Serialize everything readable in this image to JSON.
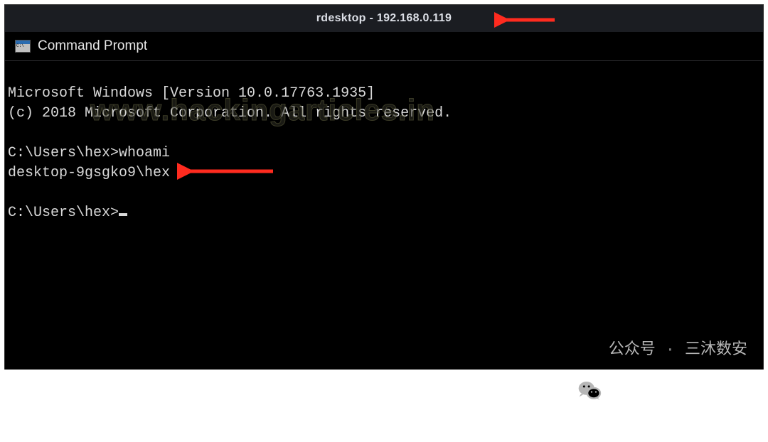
{
  "rdesktop": {
    "title": "rdesktop - 192.168.0.119"
  },
  "cmd": {
    "icon_name": "command-prompt-icon",
    "title": "Command Prompt"
  },
  "terminal_lines": {
    "l0": "Microsoft Windows [Version 10.0.17763.1935]",
    "l1": "(c) 2018 Microsoft Corporation. All rights reserved.",
    "l2": "",
    "l3_prompt": "C:\\Users\\hex>",
    "l3_cmd": "whoami",
    "l4": "desktop-9gsgko9\\hex",
    "l5": "",
    "l6_prompt": "C:\\Users\\hex>"
  },
  "watermark": {
    "text": "www.hackingarticles.in"
  },
  "wechat": {
    "label": "公众号",
    "separator": "·",
    "account": "三沐数安",
    "icon_name": "wechat-icon"
  },
  "arrows": {
    "a1_name": "annotation-arrow",
    "a2_name": "annotation-arrow"
  },
  "colors": {
    "arrow": "#ff2b1f",
    "terminal_fg": "#d9d9d9",
    "terminal_bg": "#000000",
    "titlebar_bg": "#1b1d22"
  }
}
